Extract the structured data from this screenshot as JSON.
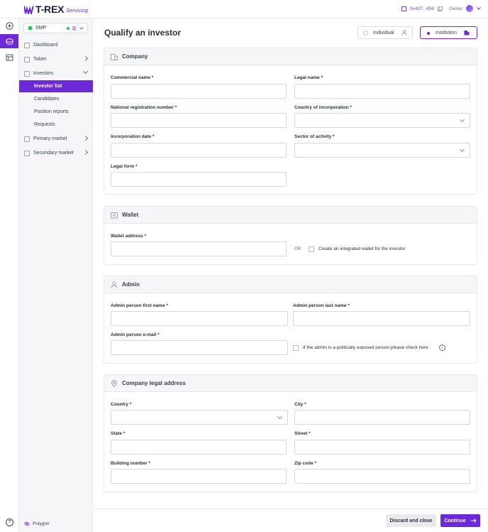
{
  "brand": {
    "name": "T-REX",
    "sub": "Servicing",
    "color": "#6d28d9"
  },
  "topbar": {
    "wallet": "0x437...456",
    "role": "Owner"
  },
  "sidebar": {
    "asset": "SMP",
    "nav": [
      {
        "label": "Dashboard",
        "icon": "dashboard-icon"
      },
      {
        "label": "Token",
        "icon": "token-icon"
      },
      {
        "label": "Investors",
        "icon": "investors-icon"
      }
    ],
    "investor_sub": [
      "Investor list",
      "Candidates",
      "Position reports",
      "Requests"
    ],
    "nav_bottom": [
      {
        "label": "Primary market",
        "icon": "primary-market-icon"
      },
      {
        "label": "Secondary market",
        "icon": "secondary-market-icon"
      }
    ],
    "network": "Polygon"
  },
  "page": {
    "title": "Qualify an investor",
    "type_individual": "Individual",
    "type_institution": "Institution"
  },
  "company": {
    "title": "Company",
    "commercial_name": "Commercial name *",
    "legal_name": "Legal name *",
    "national_reg": "National registration number *",
    "country_inc": "Country of incorporation *",
    "inc_date": "Incorporation date *",
    "sector": "Sector of activity *",
    "legal_form": "Legal form *"
  },
  "wallet": {
    "title": "Wallet",
    "address": "Wallet address *",
    "or": "OR",
    "create": "Create an integrated wallet for the investor"
  },
  "admin": {
    "title": "Admin",
    "first": "Admin person first name *",
    "last": "Admin person last name *",
    "email": "Admin person e-mail *",
    "pep": "If the admin is a politically exposed person please check here"
  },
  "address": {
    "title": "Company legal address",
    "country": "Country *",
    "city": "City *",
    "state": "State *",
    "street": "Street *",
    "building": "Building number *",
    "zip": "Zip code *"
  },
  "footer": {
    "discard": "Discard and close",
    "continue": "Continue"
  }
}
